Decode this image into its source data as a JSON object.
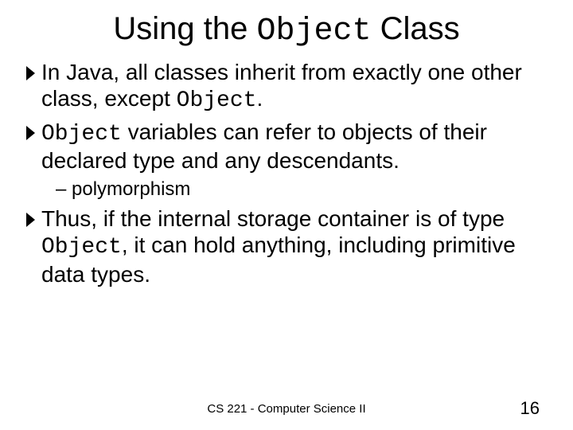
{
  "title_pre": "Using the ",
  "title_code": "Object",
  "title_post": " Class",
  "b1_a": "In Java, all classes inherit from exactly one other class, except ",
  "b1_code": "Object",
  "b1_b": ".",
  "b2_code": "Object",
  "b2_rest": " variables can refer to objects of their declared type and any descendants.",
  "sub1": "– polymorphism",
  "b3_a": "Thus, if the internal storage container is of type ",
  "b3_code": "Object",
  "b3_b": ", it can hold anything, including primitive data types.",
  "footer": "CS 221 - Computer Science II",
  "page": "16"
}
